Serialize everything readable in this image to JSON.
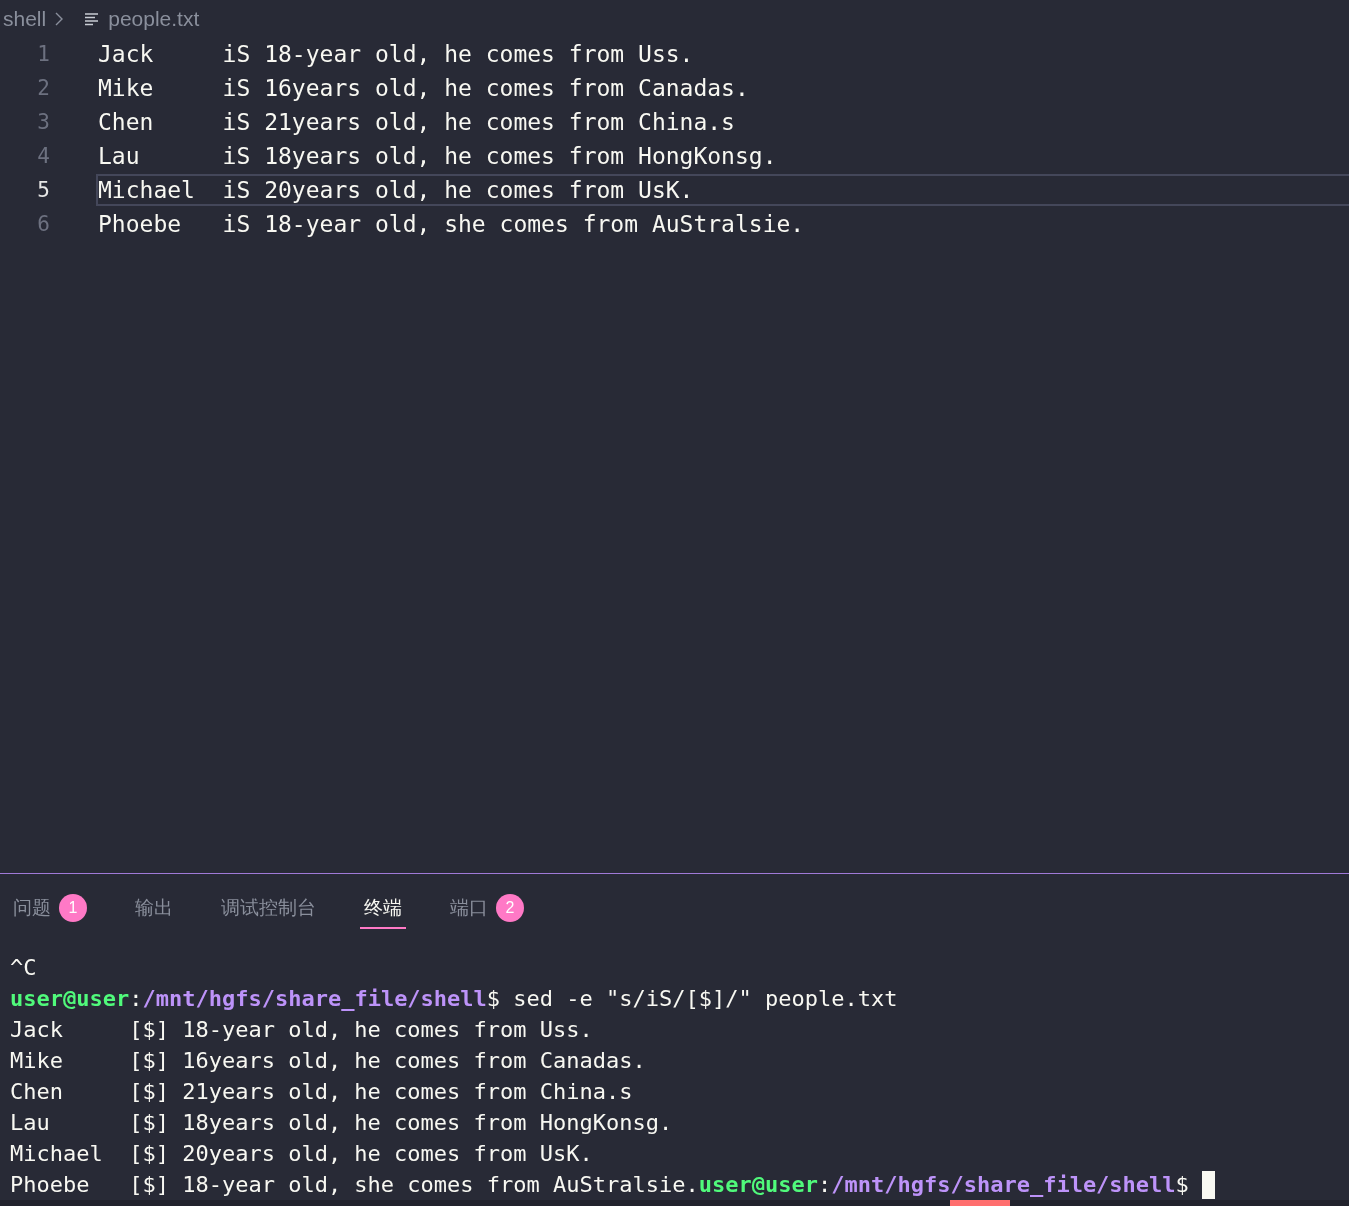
{
  "breadcrumb": {
    "folder": "shell",
    "file": "people.txt"
  },
  "editor": {
    "lines": [
      {
        "number": "1",
        "text": "Jack     iS 18-year old, he comes from Uss.",
        "current": false
      },
      {
        "number": "2",
        "text": "Mike     iS 16years old, he comes from Canadas.",
        "current": false
      },
      {
        "number": "3",
        "text": "Chen     iS 21years old, he comes from China.s",
        "current": false
      },
      {
        "number": "4",
        "text": "Lau      iS 18years old, he comes from HongKonsg.",
        "current": false
      },
      {
        "number": "5",
        "text": "Michael  iS 20years old, he comes from UsK.",
        "current": true
      },
      {
        "number": "6",
        "text": "Phoebe   iS 18-year old, she comes from AuStralsie.",
        "current": false
      }
    ]
  },
  "panel": {
    "tabs": [
      {
        "label": "问题",
        "badge": "1",
        "selected": false
      },
      {
        "label": "输出",
        "selected": false
      },
      {
        "label": "调试控制台",
        "selected": false
      },
      {
        "label": "终端",
        "selected": true
      },
      {
        "label": "端口",
        "badge": "2",
        "selected": false
      }
    ],
    "terminal": {
      "lines": [
        [
          {
            "kind": "out",
            "text": "^C"
          }
        ],
        [
          {
            "kind": "user",
            "text": "user@user"
          },
          {
            "kind": "out",
            "text": ":"
          },
          {
            "kind": "path",
            "text": "/mnt/hgfs/share_file/shell"
          },
          {
            "kind": "out",
            "text": "$ sed -e \"s/iS/[$]/\" people.txt"
          }
        ],
        [
          {
            "kind": "out",
            "text": "Jack     [$] 18-year old, he comes from Uss."
          }
        ],
        [
          {
            "kind": "out",
            "text": "Mike     [$] 16years old, he comes from Canadas."
          }
        ],
        [
          {
            "kind": "out",
            "text": "Chen     [$] 21years old, he comes from China.s"
          }
        ],
        [
          {
            "kind": "out",
            "text": "Lau      [$] 18years old, he comes from HongKonsg."
          }
        ],
        [
          {
            "kind": "out",
            "text": "Michael  [$] 20years old, he comes from UsK."
          }
        ],
        [
          {
            "kind": "out",
            "text": "Phoebe   [$] 18-year old, she comes from AuStralsie."
          },
          {
            "kind": "user",
            "text": "user@user"
          },
          {
            "kind": "out",
            "text": ":"
          },
          {
            "kind": "path",
            "text": "/mnt/hgfs/share_file/shell"
          },
          {
            "kind": "out",
            "text": "$ "
          },
          {
            "kind": "cursor"
          }
        ]
      ]
    }
  }
}
